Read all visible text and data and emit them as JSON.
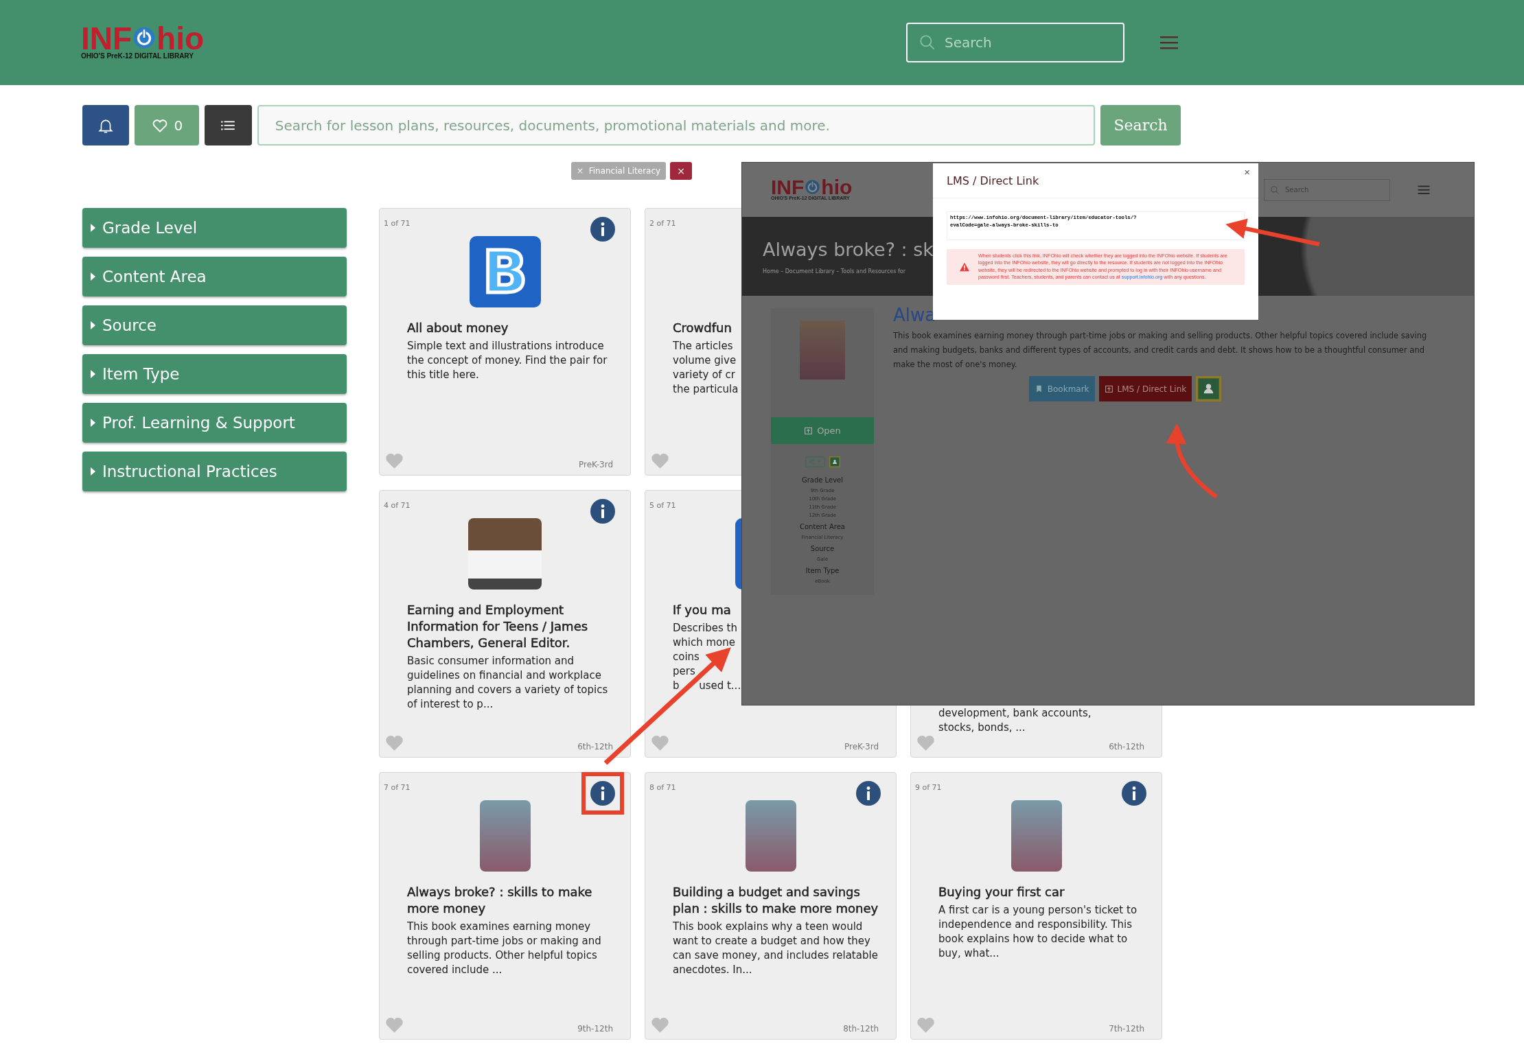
{
  "header": {
    "logo": {
      "left": "INF",
      "right": "hio",
      "tagline": "OHIO'S PreK-12 DIGITAL LIBRARY"
    },
    "search_placeholder": "Search"
  },
  "toolbar": {
    "favorites_count": "0",
    "search_placeholder": "Search for lesson plans, resources, documents, promotional materials and more.",
    "search_button": "Search"
  },
  "filters": [
    {
      "label": "Financial Literacy",
      "remove": "×"
    }
  ],
  "clear_filters": "×",
  "sidebar": {
    "items": [
      {
        "label": "Grade Level",
        "expanded": false
      },
      {
        "label": "Content Area",
        "expanded": false
      },
      {
        "label": "Source",
        "expanded": false
      },
      {
        "label": "Item Type",
        "expanded": false
      },
      {
        "label": "Prof. Learning & Support",
        "expanded": false
      },
      {
        "label": "Instructional Practices",
        "expanded": false
      }
    ]
  },
  "cards": [
    {
      "counter": "1 of 71",
      "info": true,
      "highlighted": false,
      "image": {
        "kind": "app",
        "letter": "B"
      },
      "title": "All about money",
      "description": "Simple text and illustrations introduce the concept of money. Find the pair for this title here.",
      "grade": "PreK-3rd"
    },
    {
      "counter": "2 of 71",
      "title": "Crowdfun",
      "lines": [
        "The articles",
        "volume give",
        "variety of cr",
        "the particula"
      ]
    },
    {
      "counter": "4 of 71",
      "info": true,
      "highlighted": false,
      "image": {
        "kind": "photo"
      },
      "title": "Earning and Employment Information for Teens / James Chambers, General Editor.",
      "description": "Basic consumer information and guidelines on financial and workplace planning and covers a variety of topics of interest to p...",
      "grade": "6th-12th"
    },
    {
      "counter": "5 of 71",
      "image": {
        "kind": "app"
      },
      "title": "If you ma",
      "lines": [
        "Describes th",
        "which mone",
        "coins",
        "pers",
        "b      used t..."
      ],
      "grade": "PreK-3rd"
    },
    {
      "lines": [
        "development, bank accounts,",
        "stocks, bonds, ..."
      ],
      "grade": "6th-12th"
    },
    {
      "counter": "7 of 71",
      "info": true,
      "highlighted": true,
      "image": {
        "kind": "cover"
      },
      "title": "Always broke? : skills to make more money",
      "description": "This book examines earning money through part-time jobs or making and selling products. Other helpful topics covered include ...",
      "grade": "9th-12th"
    },
    {
      "counter": "8 of 71",
      "info": true,
      "highlighted": false,
      "image": {
        "kind": "cover"
      },
      "title": "Building a budget and savings plan : skills to make more money",
      "description": "This book explains why a teen would want to create a budget and how they can save money, and includes relatable anecdotes. In...",
      "grade": "8th-12th"
    },
    {
      "counter": "9 of 71",
      "info": true,
      "highlighted": false,
      "image": {
        "kind": "cover"
      },
      "title": "Buying your first car",
      "description": "A first car is a young person's ticket to independence and responsibility. This book explains how to decide what to buy, what...",
      "grade": "7th-12th"
    }
  ],
  "inset": {
    "logo": {
      "left": "INF",
      "right": "hio",
      "tagline": "OHIO'S PreK-12 DIGITAL LIBRARY"
    },
    "search_placeholder": "Search",
    "banner_title": "Always broke? : sk",
    "breadcrumb": "Home – Document Library – Tools and Resources for",
    "open_button": "Open",
    "meta": [
      {
        "heading": "Grade Level",
        "values": [
          "9th Grade",
          "10th Grade",
          "11th Grade",
          "12th Grade"
        ]
      },
      {
        "heading": "Content Area",
        "values": [
          "Financial Literacy"
        ]
      },
      {
        "heading": "Source",
        "values": [
          "Gale"
        ]
      },
      {
        "heading": "Item Type",
        "values": [
          "eBook"
        ]
      }
    ],
    "title": "Alwa",
    "description": "This book examines earning money through part-time jobs or making and selling products. Other helpful topics covered include saving and making budgets, banks and different types of accounts, and credit cards and debt. It shows how to be a thoughtful consumer and make the most of one's money.",
    "buttons": [
      {
        "kind": "bookmark",
        "label": "Bookmark"
      },
      {
        "kind": "link",
        "label": "LMS / Direct Link"
      },
      {
        "kind": "classroom"
      }
    ],
    "modal": {
      "title": "LMS / Direct Link",
      "close": "×",
      "url_lines": [
        "https://www.infohio.org/document-library/item/educator-tools/?",
        "evalCode=gale-always-broke-skills-to"
      ],
      "alert": "When students click this link, INFOhio will check whether they are logged into the INFOhio website. If students are logged into the INFOhio website, they will go directly to the resource. If students are not logged into the INFOhio website, they will be redirected to the INFOhio website and prompted to log in with their INFOhio username and password first. Teachers, students, and parents can contact us at",
      "alert_link": "support.infohio.org",
      "alert_after": "with any questions."
    }
  }
}
